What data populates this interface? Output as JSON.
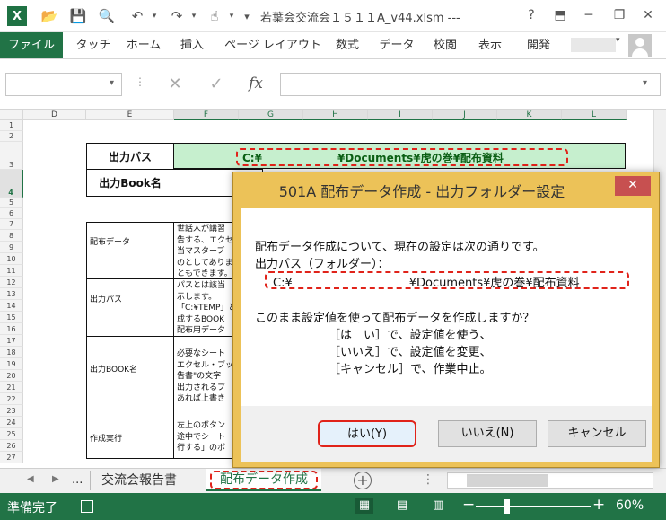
{
  "app": {
    "window_title": "若葉会交流会１５１１A_v44.xlsm ---",
    "qa_icons": [
      "save-icon",
      "open-icon",
      "preview-icon",
      "undo-icon",
      "redo-icon",
      "touch-icon"
    ]
  },
  "ribbon": {
    "tabs": [
      "ファイル",
      "タッチ",
      "ホーム",
      "挿入",
      "ページ レイアウト",
      "数式",
      "データ",
      "校閲",
      "表示",
      "開発"
    ]
  },
  "formula_bar": {
    "fx": "fx",
    "name_box": "",
    "formula": ""
  },
  "columns": [
    "D",
    "E",
    "F",
    "G",
    "H",
    "I",
    "J",
    "K",
    "L"
  ],
  "rows": [
    "1",
    "2",
    "3",
    "4",
    "5",
    "6",
    "7",
    "8",
    "9",
    "10",
    "11",
    "12",
    "13",
    "14",
    "15",
    "16",
    "17",
    "18",
    "19",
    "20",
    "21",
    "22",
    "23",
    "24",
    "25",
    "26",
    "27"
  ],
  "sheet": {
    "output_path_label": "出力パス",
    "output_path_value": "C:¥　　　　　　　¥Documents¥虎の巻¥配布資料",
    "output_book_label": "出力Book名",
    "table": [
      {
        "label": "配布データ",
        "text": "世話人が講習\n告する、エクセ\n当マスターブ\nのとしてありま\nともできます。"
      },
      {
        "label": "出力パス",
        "text": "パスとは該当\n示します。\n「C:¥TEMP」と\n成するBOOK\n配布用データ"
      },
      {
        "label": "出力BOOK名",
        "text": "必要なシート\nエクセル・ブッ\n告書\"の文字\n出力されるブ\nあれば上書き"
      },
      {
        "label": "作成実行",
        "text": "左上のボタン\n途中でシート\n行する」のボ"
      }
    ]
  },
  "sheet_tabs": {
    "dots": "...",
    "other_tab": "交流会報告書",
    "active_tab": "配布データ作成"
  },
  "status": {
    "ready": "準備完了",
    "zoom": "60%"
  },
  "dialog": {
    "title": "501A 配布データ作成 - 出力フォルダー設定",
    "close": "✕",
    "line1": "配布データ作成について、現在の設定は次の通りです。",
    "line2": "出力パス（フォルダー）：",
    "path": "C:¥　　　　　　　　　　¥Documents¥虎の巻¥配布資料",
    "question": "このまま設定値を使って配布データを作成しますか？",
    "opt_yes": "［は　い］で、設定値を使う、",
    "opt_no": "［いいえ］で、設定値を変更、",
    "opt_cancel": "［キャンセル］で、作業中止。",
    "btn_yes": "はい(Y)",
    "btn_no": "いいえ(N)",
    "btn_cancel": "キャンセル"
  }
}
